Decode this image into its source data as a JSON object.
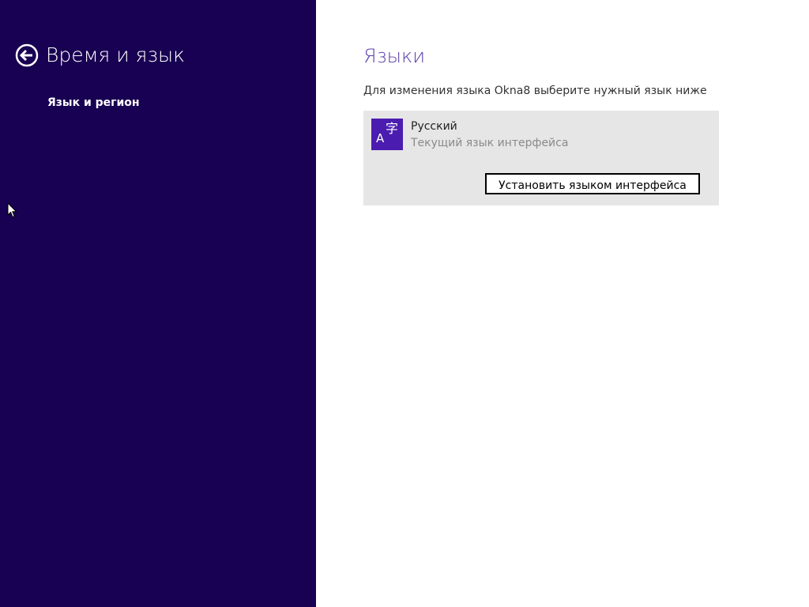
{
  "window": {
    "title": "Время и язык"
  },
  "sidebar": {
    "back_icon": "back-arrow-circle-icon",
    "items": [
      {
        "label": "Язык и регион"
      }
    ]
  },
  "main": {
    "section_title": "Языки",
    "description": "Для изменения языка Okna8 выберите нужный язык ниже",
    "language_card": {
      "icon": "language-icon",
      "icon_glyph_latin": "A",
      "icon_glyph_cjk": "字",
      "name": "Русский",
      "status": "Текущий язык интерфейса",
      "action_label": "Установить языком интерфейса"
    }
  },
  "colors": {
    "sidebar_background": "#180052",
    "accent": "#4b1cb0",
    "section_title": "#5c3ca8",
    "card_background": "#e6e6e6"
  }
}
